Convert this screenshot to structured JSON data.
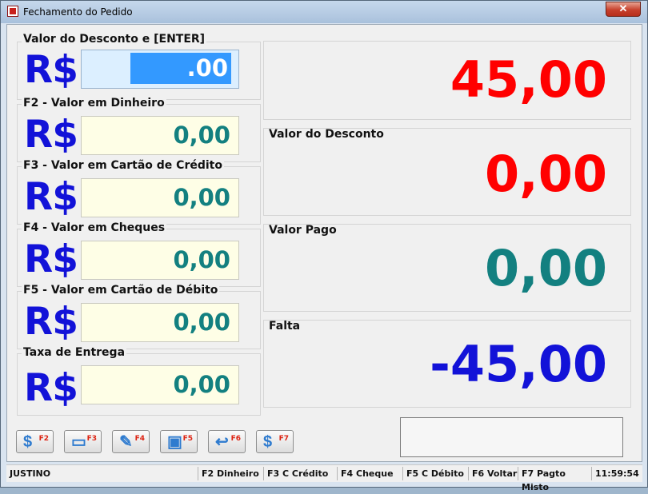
{
  "window": {
    "title": "Fechamento do Pedido",
    "close_icon": "close-icon"
  },
  "fields": [
    {
      "label": "Valor do Desconto e [ENTER]",
      "currency": "R$",
      "value": ".00",
      "selected": true
    },
    {
      "label": "F2 - Valor em Dinheiro",
      "currency": "R$",
      "value": "0,00"
    },
    {
      "label": "F3 - Valor em Cartão de Crédito",
      "currency": "R$",
      "value": "0,00"
    },
    {
      "label": "F4 - Valor em Cheques",
      "currency": "R$",
      "value": "0,00"
    },
    {
      "label": "F5 - Valor em Cartão de Débito",
      "currency": "R$",
      "value": "0,00"
    },
    {
      "label": "Taxa de Entrega",
      "currency": "R$",
      "value": "0,00"
    }
  ],
  "summary": {
    "total": {
      "value": "45,00",
      "color": "#ff0000"
    },
    "discount": {
      "label": "Valor do Desconto",
      "value": "0,00",
      "color": "#ff0000"
    },
    "paid": {
      "label": "Valor Pago",
      "value": "0,00",
      "color": "#138080"
    },
    "missing": {
      "label": "Falta",
      "value": "-45,00",
      "color": "#1212d8"
    }
  },
  "toolbar": [
    {
      "key": "F2",
      "icon": "cash-icon",
      "glyph": "$"
    },
    {
      "key": "F3",
      "icon": "credit-card-icon",
      "glyph": "▭"
    },
    {
      "key": "F4",
      "icon": "cheque-icon",
      "glyph": "✎"
    },
    {
      "key": "F5",
      "icon": "debit-card-icon",
      "glyph": "▣"
    },
    {
      "key": "F6",
      "icon": "back-arrow-icon",
      "glyph": "↩"
    },
    {
      "key": "F7",
      "icon": "mixed-payment-icon",
      "glyph": "$"
    }
  ],
  "statusbar": {
    "user": "JUSTINO",
    "hints": [
      "F2 Dinheiro",
      "F3 C Crédito",
      "F4 Cheque",
      "F5 C Débito",
      "F6 Voltar",
      "F7 Pagto Misto"
    ],
    "time": "11:59:54"
  }
}
